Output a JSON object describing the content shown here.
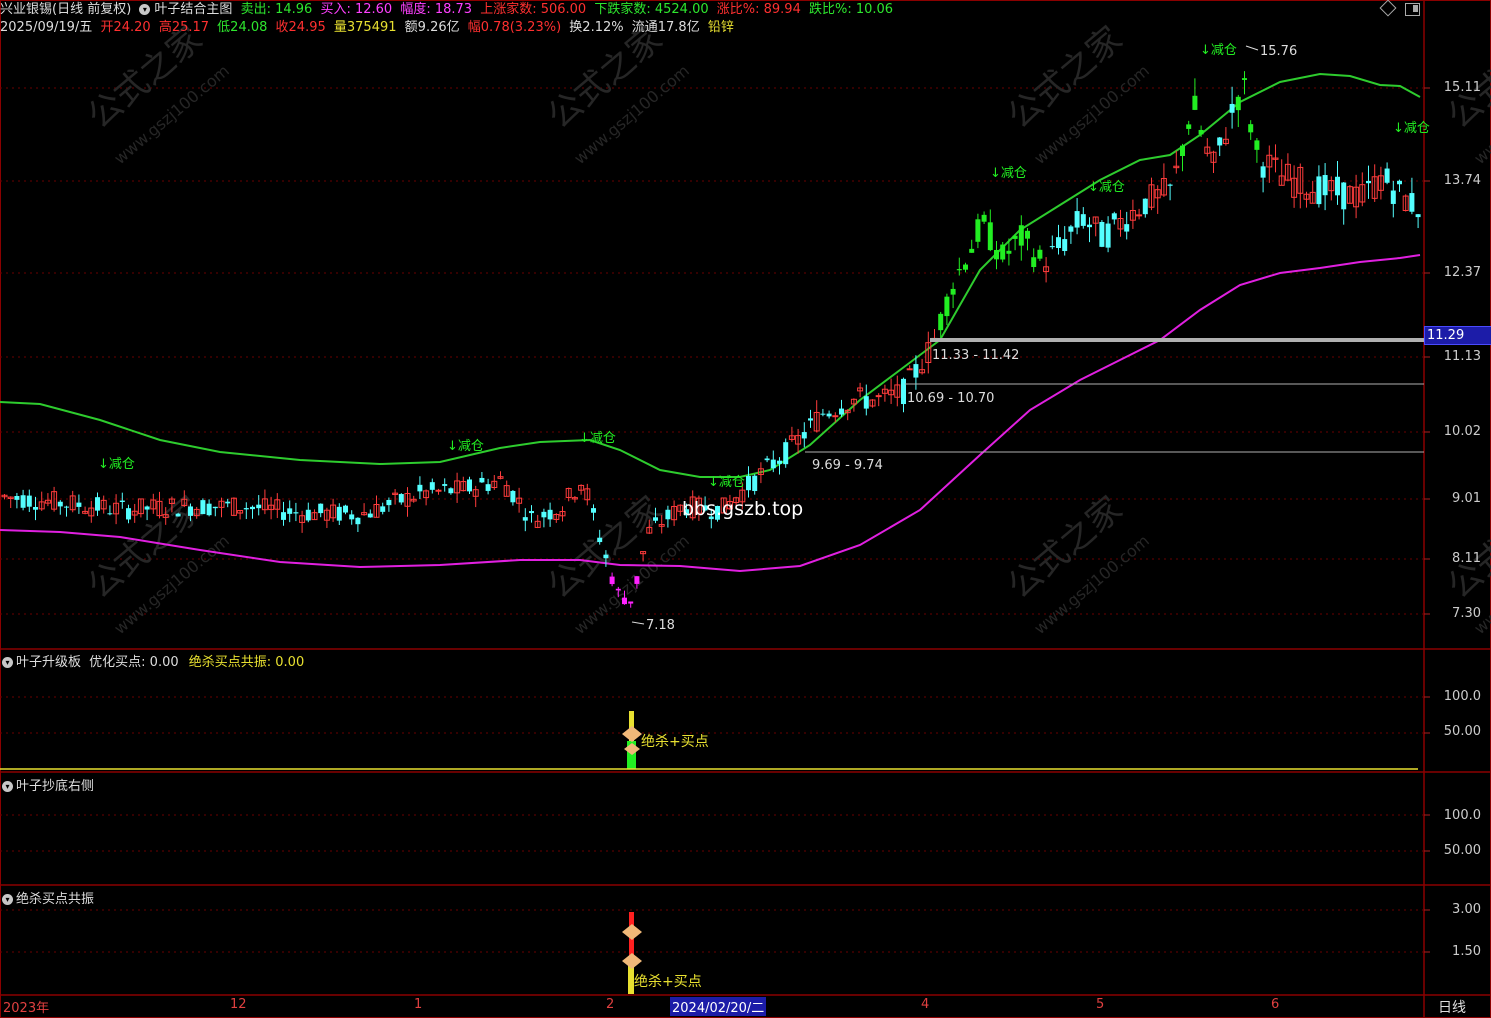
{
  "header": {
    "stock": "兴业银锡(日线 前复权)",
    "indicator": "叶子结合主图",
    "sell": "卖出: 14.96",
    "buy": "买入: 12.60",
    "amplitude": "幅度: 18.73",
    "up_count": "上涨家数: 506.00",
    "down_count": "下跌家数: 4524.00",
    "up_ratio": "涨比%: 89.94",
    "down_ratio": "跌比%: 10.06",
    "date": "2025/09/19/五",
    "open": "开24.20",
    "high": "高25.17",
    "low": "低24.08",
    "close": "收24.95",
    "volume": "量375491",
    "amount": "额9.26亿",
    "change": "幅0.78(3.23%)",
    "turnover": "换2.12%",
    "float": "流通17.8亿",
    "sector": "铅锌"
  },
  "panels": {
    "p1_title": "叶子升级板",
    "p1_val1": "优化买点: 0.00",
    "p1_val2": "绝杀买点共振: 0.00",
    "p2_title": "叶子抄底右侧",
    "p3_title": "绝杀买点共振"
  },
  "main_axis": [
    "15.11",
    "13.74",
    "12.37",
    "11.13",
    "10.02",
    "9.01",
    "8.11",
    "7.30"
  ],
  "current_price": "11.29",
  "p1_axis": [
    "100.0",
    "50.00"
  ],
  "p2_axis": [
    "100.0",
    "50.00"
  ],
  "p3_axis": [
    "3.00",
    "1.50"
  ],
  "x_labels": [
    "2023年",
    "12",
    "1",
    "2",
    "2024/02/20/二",
    "4",
    "5",
    "6"
  ],
  "period": "日线",
  "annotations": {
    "reduce": "↓减仓",
    "high_mark": "15.76",
    "low_mark": "7.18",
    "zone1": "11.33 - 11.42",
    "zone2": "10.69 - 10.70",
    "zone3": "9.69 - 9.74",
    "watermark_url": "bbs.gszb.top",
    "buy_signal": "绝杀+买点",
    "wm_cn": "公式之家",
    "wm_en": "www.gszj100.com"
  },
  "colors": {
    "up": "#ff3c3c",
    "down": "#54ffff",
    "green_band": "#2ecc2e",
    "magenta_band": "#e020e0",
    "signal_green": "#22ee22",
    "signal_magenta": "#ff22ff",
    "grid": "#8b0000"
  }
}
